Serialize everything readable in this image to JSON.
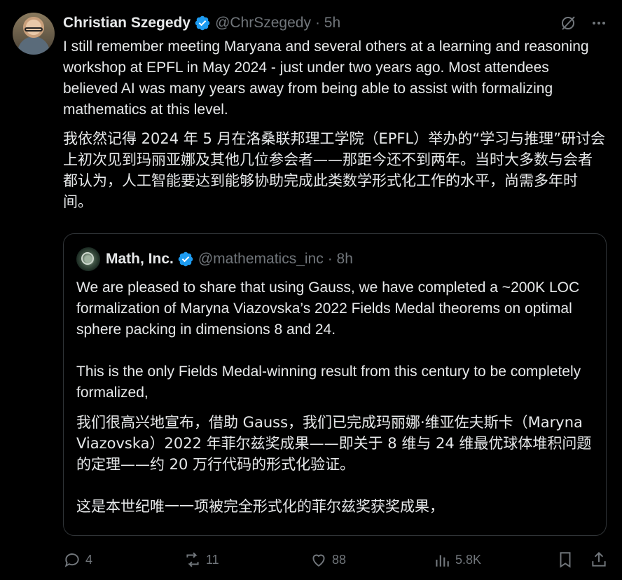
{
  "post": {
    "author_name": "Christian Szegedy",
    "author_handle": "@ChrSzegedy",
    "time": "· 5h",
    "text_en": "I still remember meeting Maryana and several others at a learning and reasoning workshop at EPFL in May 2024 - just under two years ago. Most attendees believed AI was many years away from being able to assist with formalizing mathematics at this level.",
    "text_zh": "我依然记得 2024 年 5 月在洛桑联邦理工学院（EPFL）举办的“学习与推理”研讨会上初次见到玛丽亚娜及其他几位参会者——那距今还不到两年。当时大多数与会者都认为，人工智能要达到能够协助完成此类数学形式化工作的水平，尚需多年时间。"
  },
  "quoted": {
    "author_name": "Math, Inc.",
    "author_handle": "@mathematics_inc",
    "time": "· 8h",
    "text_en_1": "We are pleased to share that using Gauss, we have completed a ~200K LOC formalization of Maryna Viazovska’s 2022 Fields Medal theorems on optimal sphere packing in dimensions 8 and 24.",
    "text_en_2": "This is the only Fields Medal-winning result from this century to be completely formalized,",
    "text_zh_1": "我们很高兴地宣布，借助 Gauss，我们已完成玛丽娜·维亚佐夫斯卡（Maryna Viazovska）2022 年菲尔兹奖成果——即关于 8 维与 24 维最优球体堆积问题的定理——约 20 万行代码的形式化验证。",
    "text_zh_2": "这是本世纪唯一一项被完全形式化的菲尔兹奖获奖成果，"
  },
  "actions": {
    "replies": "4",
    "reposts": "11",
    "likes": "88",
    "views": "5.8K"
  },
  "colors": {
    "background": "#000000",
    "text": "#e7e9ea",
    "muted": "#71767b",
    "verified": "#1d9bf0",
    "border": "#2f3336"
  },
  "icons": [
    "verified-badge-icon",
    "grok-icon",
    "more-icon",
    "reply-icon",
    "repost-icon",
    "like-icon",
    "views-icon",
    "bookmark-icon",
    "share-icon"
  ]
}
